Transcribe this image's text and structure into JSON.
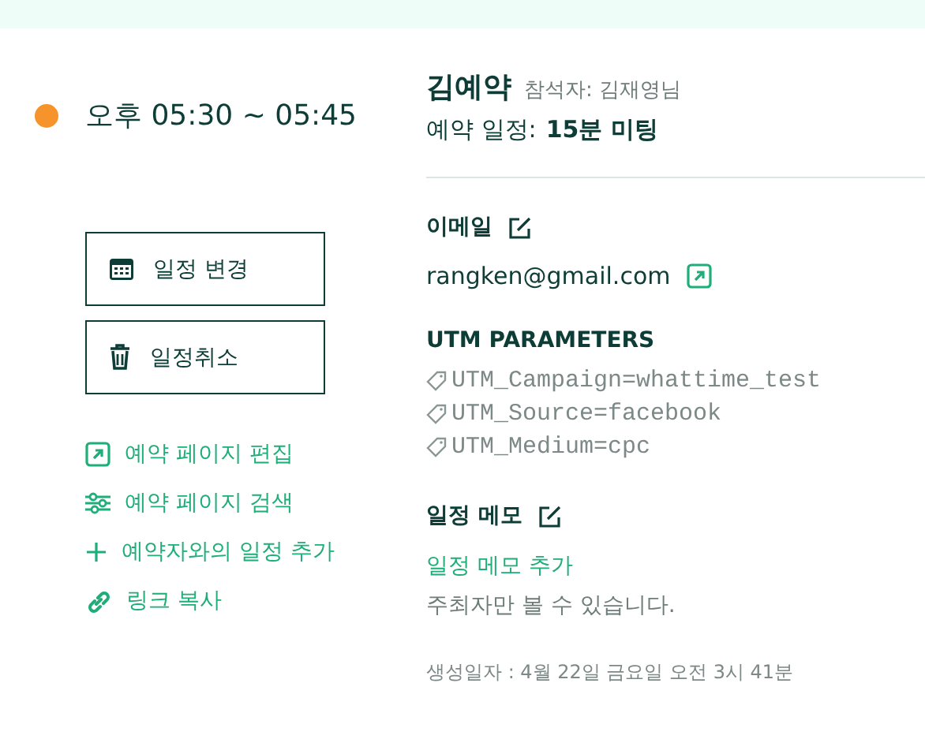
{
  "event": {
    "color": "#f7932b",
    "time": "오후 05:30 ~ 05:45"
  },
  "actions": [
    {
      "kind": "calendar",
      "label": "일정 변경"
    },
    {
      "kind": "trash",
      "label": "일정취소"
    }
  ],
  "links": [
    {
      "kind": "external",
      "label": "예약 페이지 편집"
    },
    {
      "kind": "sliders",
      "label": "예약 페이지 검색"
    },
    {
      "kind": "plus",
      "label": "예약자와의 일정 추가"
    },
    {
      "kind": "link",
      "label": "링크 복사"
    }
  ],
  "booking": {
    "name": "김예약",
    "attendee": "참석자: 김재영님",
    "schedule_label": "예약 일정:",
    "schedule_value": "15분 미팅"
  },
  "email": {
    "heading": "이메일",
    "value": "rangken@gmail.com"
  },
  "utm": {
    "heading": "UTM PARAMETERS",
    "items": [
      "UTM_Campaign=whattime_test",
      "UTM_Source=facebook",
      "UTM_Medium=cpc"
    ]
  },
  "memo": {
    "heading": "일정 메모",
    "add_link": "일정 메모 추가",
    "note": "주최자만 볼 수 있습니다."
  },
  "created": "생성일자 : 4월 22일 금요일 오전 3시 41분"
}
